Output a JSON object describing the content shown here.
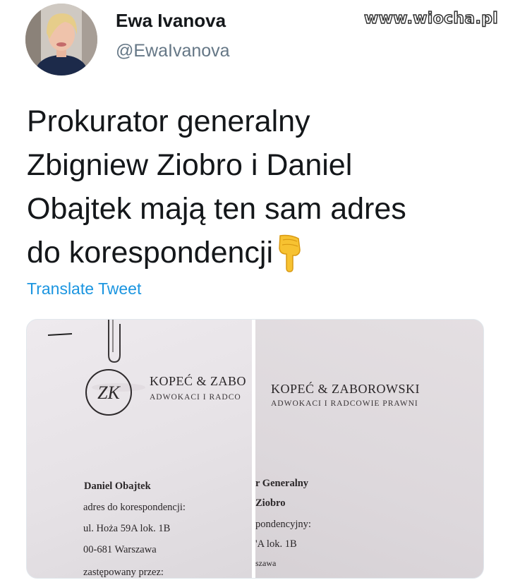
{
  "user": {
    "display_name": "Ewa Ivanova",
    "handle": "@EwaIvanova"
  },
  "watermark": "www.wiocha.pl",
  "tweet": {
    "lines": [
      "Prokurator generalny",
      "Zbigniew Ziobro i Daniel",
      "Obajtek mają ten sam adres",
      "do korespondencji"
    ],
    "emoji": "backhand-index-pointing-down-icon"
  },
  "translate_label": "Translate Tweet",
  "media": {
    "left": {
      "logo_letters": "ZK",
      "firm_name": "KOPEĆ & ZABO",
      "firm_sub": "ADWOKACI I RADCO",
      "name": "Daniel Obajtek",
      "label": "adres do korespondencji:",
      "street": "ul. Hoża 59A lok. 1B",
      "city": "00-681 Warszawa",
      "represented": "zastępowany przez:"
    },
    "right": {
      "firm_name": "KOPEĆ & ZABOROWSKI",
      "firm_sub": "ADWOKACI I RADCOWIE PRAWNI",
      "line1": "r Generalny",
      "line2": "Ziobro",
      "line3": "pondencyjny:",
      "line4": "'A lok. 1B",
      "line5": "szawa"
    }
  },
  "colors": {
    "text": "#14171a",
    "muted": "#657786",
    "link": "#1b95e0"
  }
}
